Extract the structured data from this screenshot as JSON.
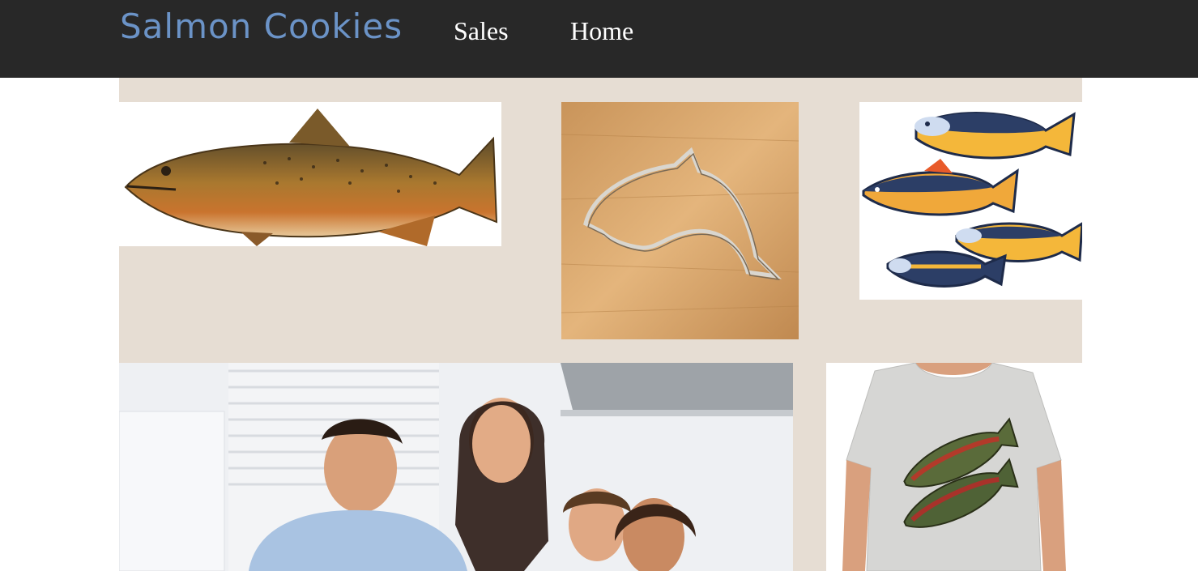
{
  "header": {
    "brand": "Salmon Cookies",
    "nav": [
      {
        "label": "Sales"
      },
      {
        "label": "Home"
      }
    ]
  },
  "colors": {
    "header_bg": "#282828",
    "brand": "#6b93c7",
    "gallery_bg": "#e6ddd3"
  },
  "gallery": {
    "images": [
      {
        "name": "salmon-illustration-image"
      },
      {
        "name": "fish-cookie-cutter-image"
      },
      {
        "name": "painted-fish-image"
      },
      {
        "name": "family-photo-image"
      },
      {
        "name": "salmon-tshirt-image"
      }
    ]
  }
}
